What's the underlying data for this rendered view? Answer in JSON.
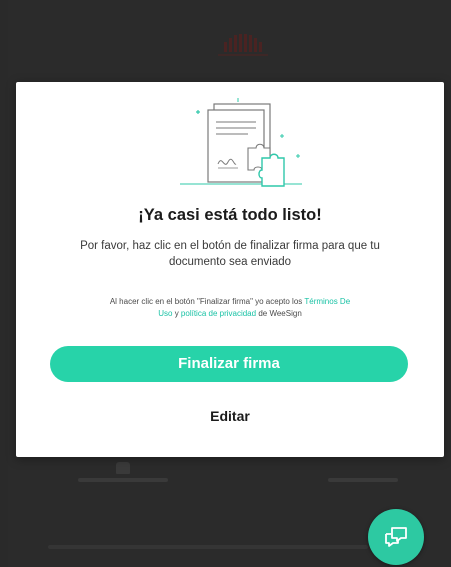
{
  "modal": {
    "title": "¡Ya casi está todo listo!",
    "description": "Por favor, haz clic en el botón de finalizar firma para que tu documento sea enviado",
    "legal": {
      "prefix": "Al hacer clic en el botón \"Finalizar firma\" yo acepto los",
      "terms_link": "Términos De Uso",
      "and": "y",
      "privacy_link": "política de privacidad",
      "of": "de",
      "brand": "WeeSign"
    },
    "finalize_label": "Finalizar firma",
    "edit_label": "Editar"
  },
  "icons": {
    "illustration": "document-puzzle-illustration",
    "chat": "chat-bubbles-icon",
    "background_logo": "brand-logo"
  },
  "colors": {
    "accent": "#27d3a9",
    "link": "#19c2a5",
    "overlay_background": "#2b2b2b",
    "fab": "#2dc9a2"
  }
}
